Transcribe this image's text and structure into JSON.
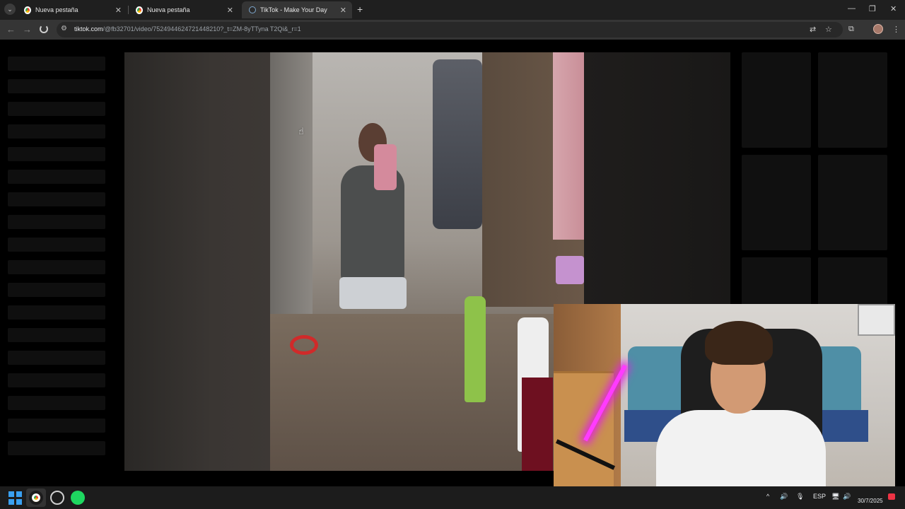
{
  "browser": {
    "tabs": [
      {
        "title": "Nueva pestaña",
        "active": false
      },
      {
        "title": "Nueva pestaña",
        "active": false
      },
      {
        "title": "TikTok - Make Your Day",
        "active": true
      }
    ],
    "new_tab_glyph": "+",
    "close_glyph": "✕",
    "window_controls": {
      "minimize": "—",
      "restore": "❐",
      "close": "✕"
    },
    "url_host": "tiktok.com",
    "url_path": "/@fb32701/video/7524944624721448210?_t=ZM-8yTTyna T2Qi&_r=1",
    "nav": {
      "back": "←",
      "forward": "→"
    }
  },
  "page": {
    "state": "loading"
  },
  "taskbar": {
    "apps": [
      "windows-start",
      "chrome",
      "obs",
      "spotify"
    ],
    "tray": {
      "chevron": "^",
      "volume": "🔊",
      "language": "ESP",
      "date": "30/7/2025"
    }
  }
}
